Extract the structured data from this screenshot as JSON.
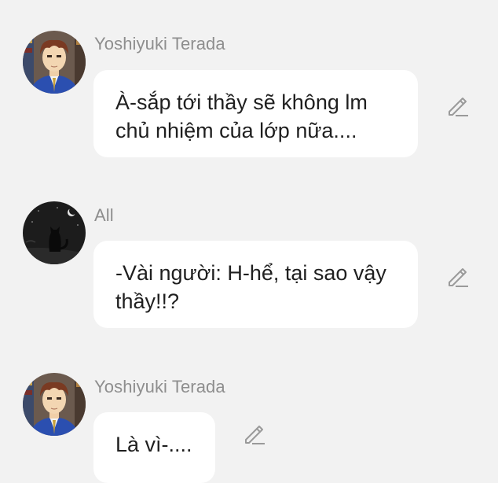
{
  "messages": [
    {
      "sender": "Yoshiyuki Terada",
      "avatar_icon": "character-avatar",
      "lines": [
        "À-sắp tới thầy sẽ không lm",
        "chủ nhiệm của lớp nữa...."
      ],
      "action_icon": "edit-pencil-icon"
    },
    {
      "sender": "All",
      "avatar_icon": "cat-night-avatar",
      "lines": [
        "-Vài người: H-hể, tại sao vậy",
        "thầy!!?"
      ],
      "action_icon": "edit-pencil-icon"
    },
    {
      "sender": "Yoshiyuki Terada",
      "avatar_icon": "character-avatar",
      "lines": [
        "Là vì-...."
      ],
      "action_icon": "edit-pencil-icon"
    }
  ],
  "colors": {
    "background": "#f2f2f2",
    "bubble": "#ffffff",
    "sender_text": "#8e8e8e",
    "message_text": "#1f1f1f",
    "icon": "#9a9a9a"
  }
}
